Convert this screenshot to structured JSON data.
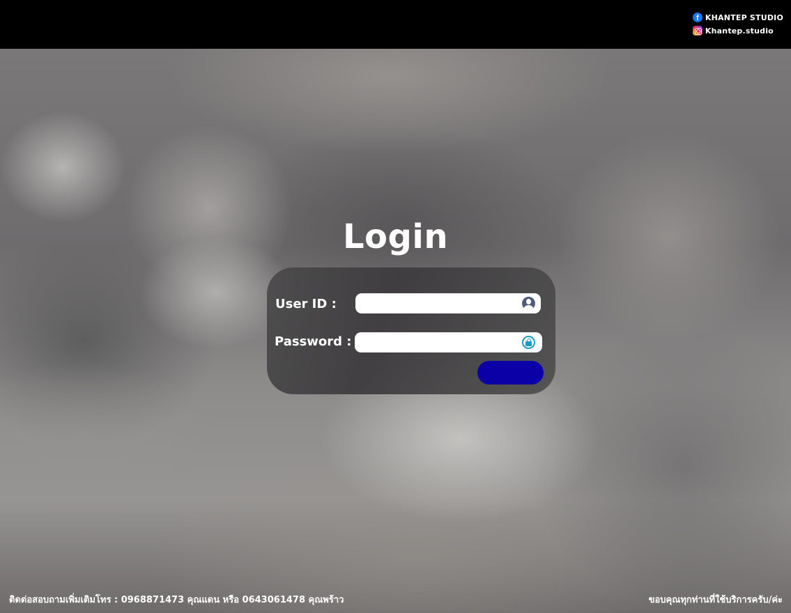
{
  "header": {
    "facebook": {
      "icon": "facebook-icon",
      "label": "KHANTEP STUDIO",
      "color": "#1877f2"
    },
    "instagram": {
      "icon": "instagram-icon",
      "label": "Khantep.studio"
    }
  },
  "login": {
    "title": "Login",
    "user_label": "User ID :",
    "user_icon": "user-icon",
    "password_label": "Password :",
    "password_icon": "lock-icon",
    "submit_label": "",
    "button_color": "#0b00a8"
  },
  "footer": {
    "contact": "ติดต่อสอบถามเพิ่มเติมโทร : 0968871473 คุณแดน หรือ 0643061478 คุณพร้าว",
    "thanks": "ขอบคุณทุกท่านที่ใช้บริการครับ/ค่ะ"
  }
}
